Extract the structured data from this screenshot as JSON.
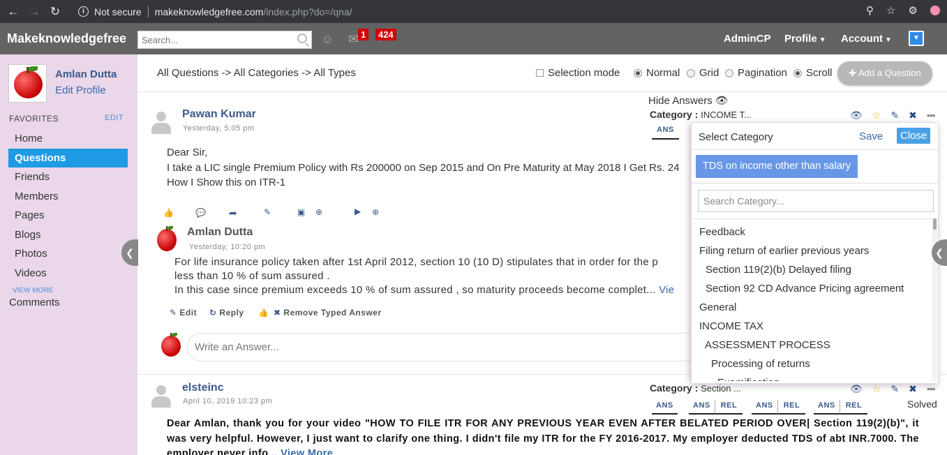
{
  "browser": {
    "secure_label": "Not secure",
    "url_host": "makeknowledgefree.com",
    "url_path": "/index.php?do=/qna/"
  },
  "header": {
    "logo": "Makeknowledgefree",
    "search_placeholder": "Search...",
    "messages_badge": "1",
    "notifications_badge": "424",
    "admincp": "AdminCP",
    "profile": "Profile",
    "account": "Account"
  },
  "sidebar": {
    "user_name": "Amlan Dutta",
    "edit_profile": "Edit Profile",
    "favorites_label": "FAVORITES",
    "favorites_edit": "EDIT",
    "items": [
      {
        "label": "Home"
      },
      {
        "label": "Questions"
      },
      {
        "label": "Friends"
      },
      {
        "label": "Members"
      },
      {
        "label": "Pages"
      },
      {
        "label": "Blogs"
      },
      {
        "label": "Photos"
      },
      {
        "label": "Videos"
      }
    ],
    "view_more": "VIEW MORE",
    "comments": "Comments"
  },
  "toolbar": {
    "breadcrumb": "All Questions -> All Categories -> All Types",
    "selection_mode": "Selection mode",
    "normal": "Normal",
    "grid": "Grid",
    "pagination": "Pagination",
    "scroll": "Scroll",
    "add_question": "Add a Question"
  },
  "question1": {
    "author": "Pawan Kumar",
    "time": "Yesterday, 5:05 pm",
    "line1": "Dear Sir,",
    "line2": "I take a LIC single Premium Policy with Rs 200000 on Sep 2015 and On Pre Maturity at May 2018 I Get Rs. 24",
    "line3": "How I Show this on ITR-1",
    "hide_answers": "Hide Answers",
    "category_label": "Category :",
    "category_value": "INCOME T...",
    "tab_ans": "ANS",
    "answer": {
      "author": "Amlan Dutta",
      "time": "Yesterday, 10:20 pm",
      "line1": "For life insurance policy taken after 1st April 2012, section 10 (10 D) stipulates that in order for the p",
      "line2": "less than 10 % of sum assured .",
      "line3": "In this case since premium exceeds 10 % of sum assured , so maturity proceeds become complet...",
      "view_more": "Vie",
      "edit": "Edit",
      "reply": "Reply",
      "remove": "Remove Typed Answer"
    },
    "write_answer_placeholder": "Write an Answer..."
  },
  "question2": {
    "author": "elsteinc",
    "time": "April 10, 2019 10:23 pm",
    "category_label": "Category :",
    "category_value": "Section ...",
    "tabs": [
      "ANS",
      "ANS",
      "REL",
      "ANS",
      "REL",
      "ANS",
      "REL"
    ],
    "solved": "Solved",
    "text": "Dear Amlan, thank you for your video \"HOW TO FILE ITR FOR ANY PREVIOUS YEAR EVEN AFTER BELATED PERIOD OVER| Section 119(2)(b)\", it was very helpful. However, I just want to clarify one thing. I didn't file my ITR for the FY 2016-2017. My employer deducted TDS of abt INR.7000. The employer never info...",
    "view_more": "View More"
  },
  "category_popup": {
    "title": "Select Category",
    "save": "Save",
    "close": "Close",
    "selected_chip": "TDS on income other than salary",
    "search_placeholder": "Search Category...",
    "items": [
      {
        "label": "Feedback",
        "indent": 0
      },
      {
        "label": "Filing return of earlier previous years",
        "indent": 0
      },
      {
        "label": "Section 119(2)(b) Delayed filing",
        "indent": 1
      },
      {
        "label": "Section 92 CD Advance Pricing agreement",
        "indent": 1
      },
      {
        "label": "General",
        "indent": 0
      },
      {
        "label": "INCOME TAX",
        "indent": 0
      },
      {
        "label": "ASSESSMENT PROCESS",
        "indent": 1
      },
      {
        "label": "Processing of returns",
        "indent": 2
      },
      {
        "label": "Examification",
        "indent": 3
      }
    ]
  }
}
